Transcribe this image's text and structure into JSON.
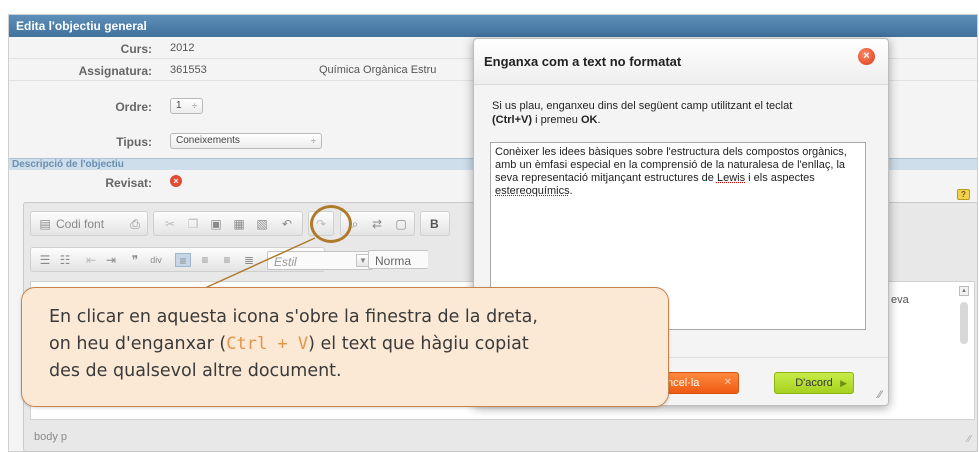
{
  "form": {
    "header_title": "Edita l'objectiu general",
    "course": {
      "label": "Curs:",
      "value": "2012"
    },
    "subject": {
      "label": "Assignatura:",
      "code": "361553",
      "name": "Química Orgànica Estru"
    },
    "order": {
      "label": "Ordre:",
      "value": "1"
    },
    "type": {
      "label": "Tipus:",
      "value": "Coneixements"
    },
    "section_label": "Descripció de l'objectiu",
    "reviewed": {
      "label": "Revisat:"
    }
  },
  "editor": {
    "source_button": "Codi font",
    "bold_label": "B",
    "style_combo": "Estil",
    "format_combo": "Norma",
    "content_fragment": "eva",
    "status_path": "body  p"
  },
  "dialog": {
    "title": "Enganxa com a text no formatat",
    "instructions_1": "Si us plau, enganxeu dins del següent camp utilitzant el teclat",
    "instructions_shortcut": "(Ctrl+V)",
    "instructions_2": " i premeu ",
    "instructions_ok": "OK",
    "instructions_3": ".",
    "textarea_before_lewis": "Conèixer les idees bàsiques sobre l'estructura dels compostos orgànics, amb un èmfasi especial en la comprensió de la naturalesa de l'enllaç, la seva representació mitjançant estructures de ",
    "textarea_lewis": "Lewis",
    "textarea_middle": " i els aspectes ",
    "textarea_stereo": "estereoquímics",
    "textarea_end": ".",
    "cancel_label": "ncel·la",
    "ok_label": "D'acord"
  },
  "callout": {
    "line1": "En clicar en aquesta icona s'obre la finestra de la dreta,",
    "line2_before": "on heu d'enganxar (",
    "line2_shortcut": "Ctrl + V",
    "line2_after": ") el text que hàgiu copiat",
    "line3": "des de qualsevol altre document."
  },
  "colors": {
    "header_blue": "#41729e",
    "callout_fill": "#fbe9d6",
    "callout_border": "#c9834a",
    "cancel_orange": "#ef5a12",
    "ok_green": "#a5d11e",
    "close_red": "#d93a14"
  }
}
